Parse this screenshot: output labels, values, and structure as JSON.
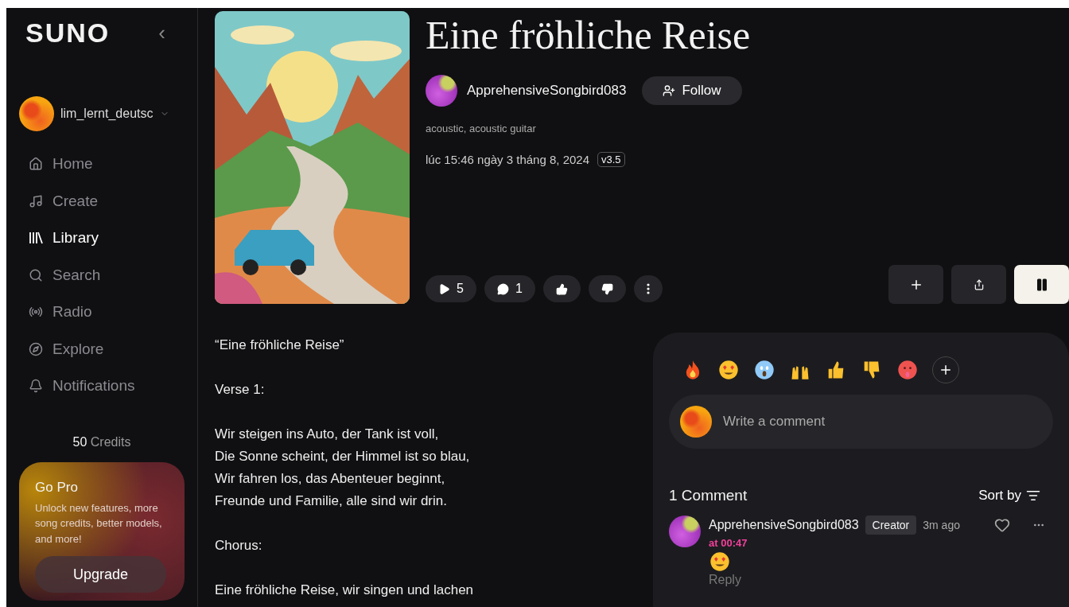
{
  "sidebar": {
    "logo": "SUNO",
    "collapse": "‹",
    "user": {
      "name": "lim_lernt_deutsc"
    },
    "nav": [
      {
        "label": "Home",
        "selected": false
      },
      {
        "label": "Create",
        "selected": false
      },
      {
        "label": "Library",
        "selected": true
      },
      {
        "label": "Search",
        "selected": false
      },
      {
        "label": "Radio",
        "selected": false
      },
      {
        "label": "Explore",
        "selected": false
      },
      {
        "label": "Notifications",
        "selected": false
      }
    ],
    "credits": {
      "count": "50",
      "label": "Credits"
    },
    "promo": {
      "title": "Go Pro",
      "text": "Unlock new features, more song credits, better models, and more!",
      "button": "Upgrade"
    }
  },
  "song": {
    "title": "Eine fröhliche Reise",
    "artist": "ApprehensiveSongbird083",
    "follow": "Follow",
    "tags": "acoustic, acoustic guitar",
    "date": "lúc 15:46 ngày 3 tháng 8, 2024",
    "version": "v3.5",
    "stats": [
      {
        "kind": "play",
        "count": "5"
      },
      {
        "kind": "comment",
        "count": "1"
      },
      {
        "kind": "like"
      },
      {
        "kind": "dislike"
      },
      {
        "kind": "more"
      }
    ],
    "actions": [
      {
        "kind": "add",
        "selected": false
      },
      {
        "kind": "share",
        "selected": false
      },
      {
        "kind": "pause",
        "selected": true
      }
    ]
  },
  "lyrics": [
    [
      "“Eine fröhliche Reise”"
    ],
    [
      "Verse 1:"
    ],
    [
      "Wir steigen ins Auto, der Tank ist voll,",
      "Die Sonne scheint, der Himmel ist so blau,",
      "Wir fahren los, das Abenteuer beginnt,",
      "Freunde und Familie, alle sind wir drin."
    ],
    [
      "Chorus:"
    ],
    [
      "Eine fröhliche Reise, wir singen und lachen"
    ]
  ],
  "comments": {
    "reactions": [
      {
        "kind": "fire"
      },
      {
        "kind": "heart-eyes"
      },
      {
        "kind": "scream"
      },
      {
        "kind": "raised-hands"
      },
      {
        "kind": "thumbs-up"
      },
      {
        "kind": "thumbs-down"
      },
      {
        "kind": "hot-face"
      },
      {
        "kind": "add"
      }
    ],
    "placeholder": "Write a comment",
    "count": "1 Comment",
    "sort": "Sort by",
    "items": [
      {
        "author": "ApprehensiveSongbird083",
        "badge": "Creator",
        "time": "3m ago",
        "timestamp": "at 00:47",
        "body": {
          "kind": "heart-eyes"
        },
        "reply": "Reply",
        "liked": false
      }
    ]
  }
}
